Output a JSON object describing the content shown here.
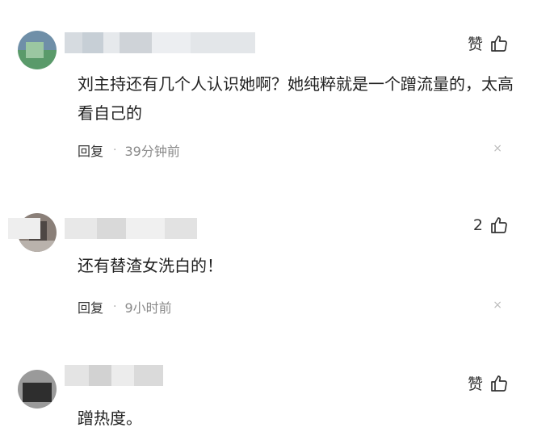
{
  "comments": [
    {
      "like_label": "赞",
      "text": "刘主持还有几个人认识她啊？她纯粹就是一个蹭流量的，太高看自己的",
      "reply_label": "回复",
      "separator": "·",
      "time": "39分钟前",
      "close": "×"
    },
    {
      "like_label": "2",
      "text": "还有替渣女洗白的！",
      "reply_label": "回复",
      "separator": "·",
      "time": "9小时前",
      "close": "×"
    },
    {
      "like_label": "赞",
      "text": "蹭热度。"
    }
  ],
  "colors": {
    "text": "#222222",
    "muted": "#8a8a8a",
    "background": "#ffffff"
  },
  "icons": [
    "thumbs-up-icon",
    "close-icon"
  ]
}
